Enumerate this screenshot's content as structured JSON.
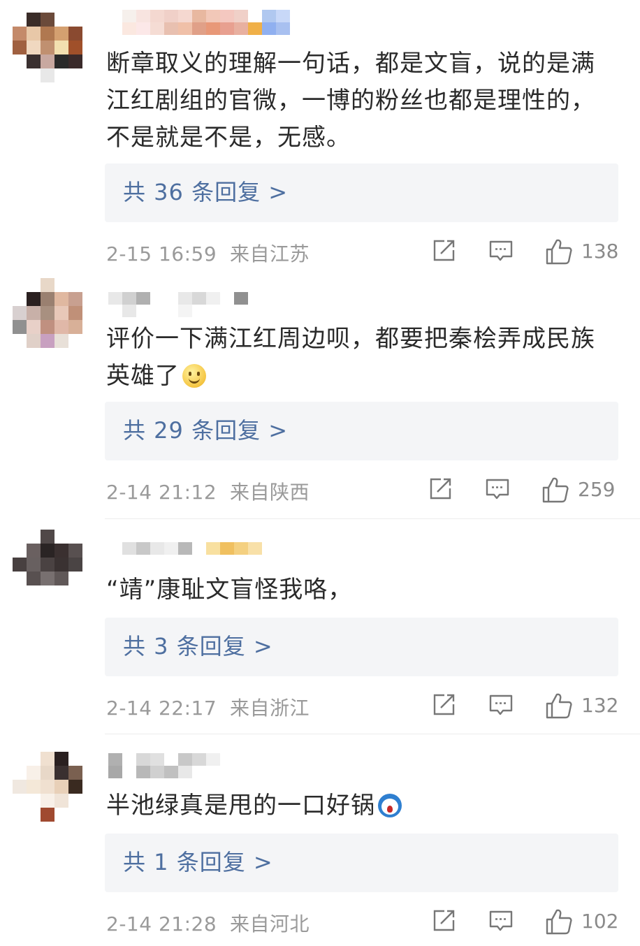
{
  "colors": {
    "reply_link": "#4e6fa0",
    "reply_box_bg": "#f4f5f7",
    "meta_text": "#9a9a9a",
    "comment_text": "#2a2a2a"
  },
  "icons": {
    "share": "share-icon",
    "comment": "comment-icon",
    "like": "like-icon"
  },
  "comments": [
    {
      "text": "断章取义的理解一句话，都是文盲，说的是满江红剧组的官微，一博的粉丝也都是理性的，不是就是不是，无感。",
      "replies_label": "共 36 条回复 >",
      "time": "2-15 16:59",
      "location": "来自江苏",
      "likes": "138"
    },
    {
      "text": "评价一下满江红周边呗，都要把秦桧弄成民族英雄了",
      "emoji": "smile-emoji",
      "replies_label": "共 29 条回复 >",
      "time": "2-14 21:12",
      "location": "来自陕西",
      "likes": "259"
    },
    {
      "text": "“靖”康耻文盲怪我咯，",
      "replies_label": "共 3 条回复 >",
      "time": "2-14 22:17",
      "location": "来自浙江",
      "likes": "132"
    },
    {
      "text": "半池绿真是甩的一口好锅",
      "emoji": "doraemon-emoji",
      "replies_label": "共 1 条回复 >",
      "time": "2-14 21:28",
      "location": "来自河北",
      "likes": "102"
    }
  ]
}
